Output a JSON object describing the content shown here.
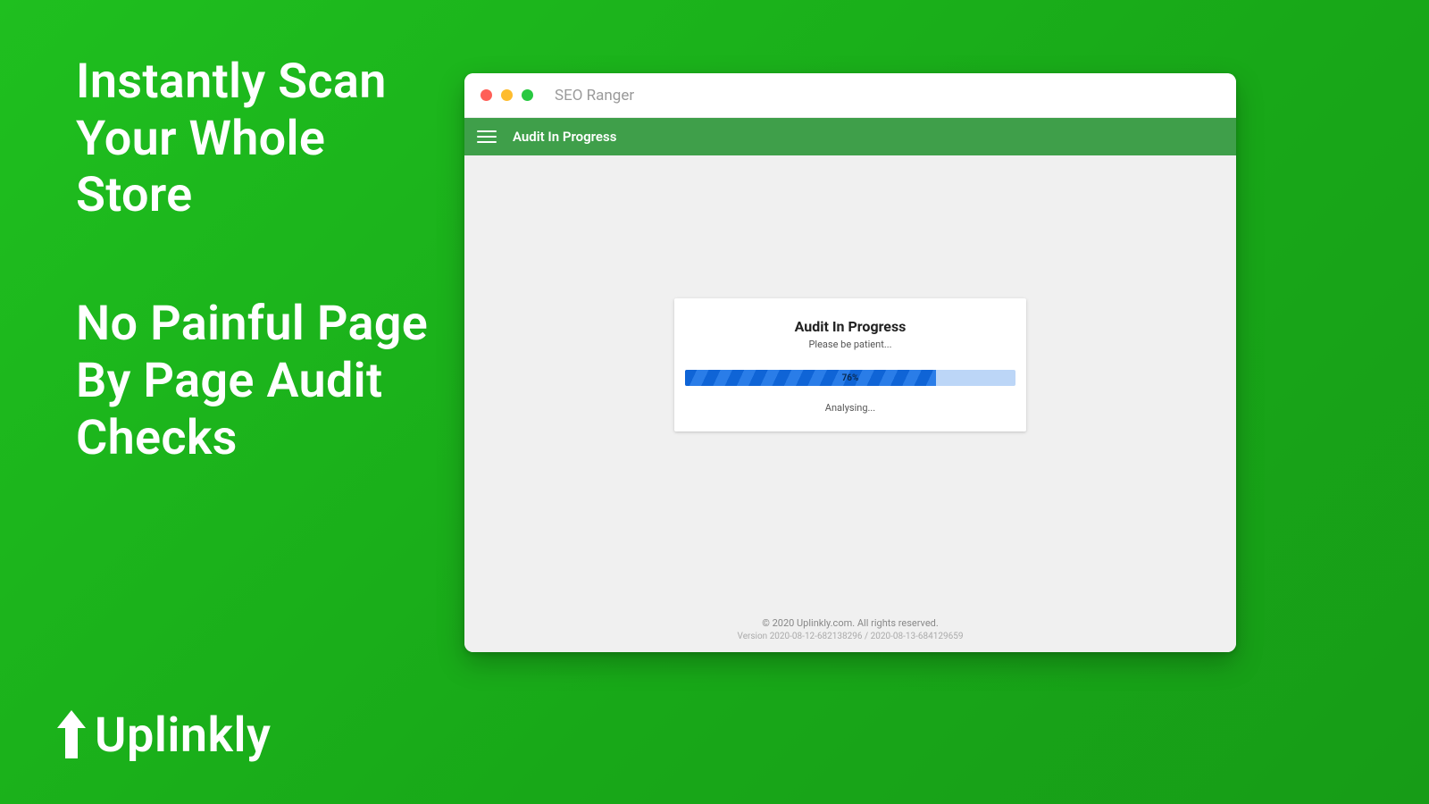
{
  "marketing": {
    "headline1": "Instantly Scan Your Whole Store",
    "headline2": "No Painful Page By Page Audit Checks",
    "brand_name": "Uplinkly"
  },
  "window": {
    "title": "SEO Ranger",
    "traffic_colors": {
      "close": "#ff5f57",
      "min": "#febc2e",
      "max": "#28c840"
    }
  },
  "appbar": {
    "title": "Audit In Progress",
    "menu_icon": "hamburger-icon"
  },
  "card": {
    "title": "Audit In Progress",
    "subtitle": "Please be patient...",
    "progress_percent": 76,
    "progress_label": "76%",
    "status": "Analysing..."
  },
  "footer": {
    "copyright": "© 2020 Uplinkly.com. All rights reserved.",
    "version": "Version 2020-08-12-682138296 / 2020-08-13-684129659"
  },
  "colors": {
    "appbar": "#3f9f4a",
    "progress_fill_a": "#0f64d6",
    "progress_fill_b": "#2a7de8",
    "progress_track": "#bcd6f7"
  }
}
